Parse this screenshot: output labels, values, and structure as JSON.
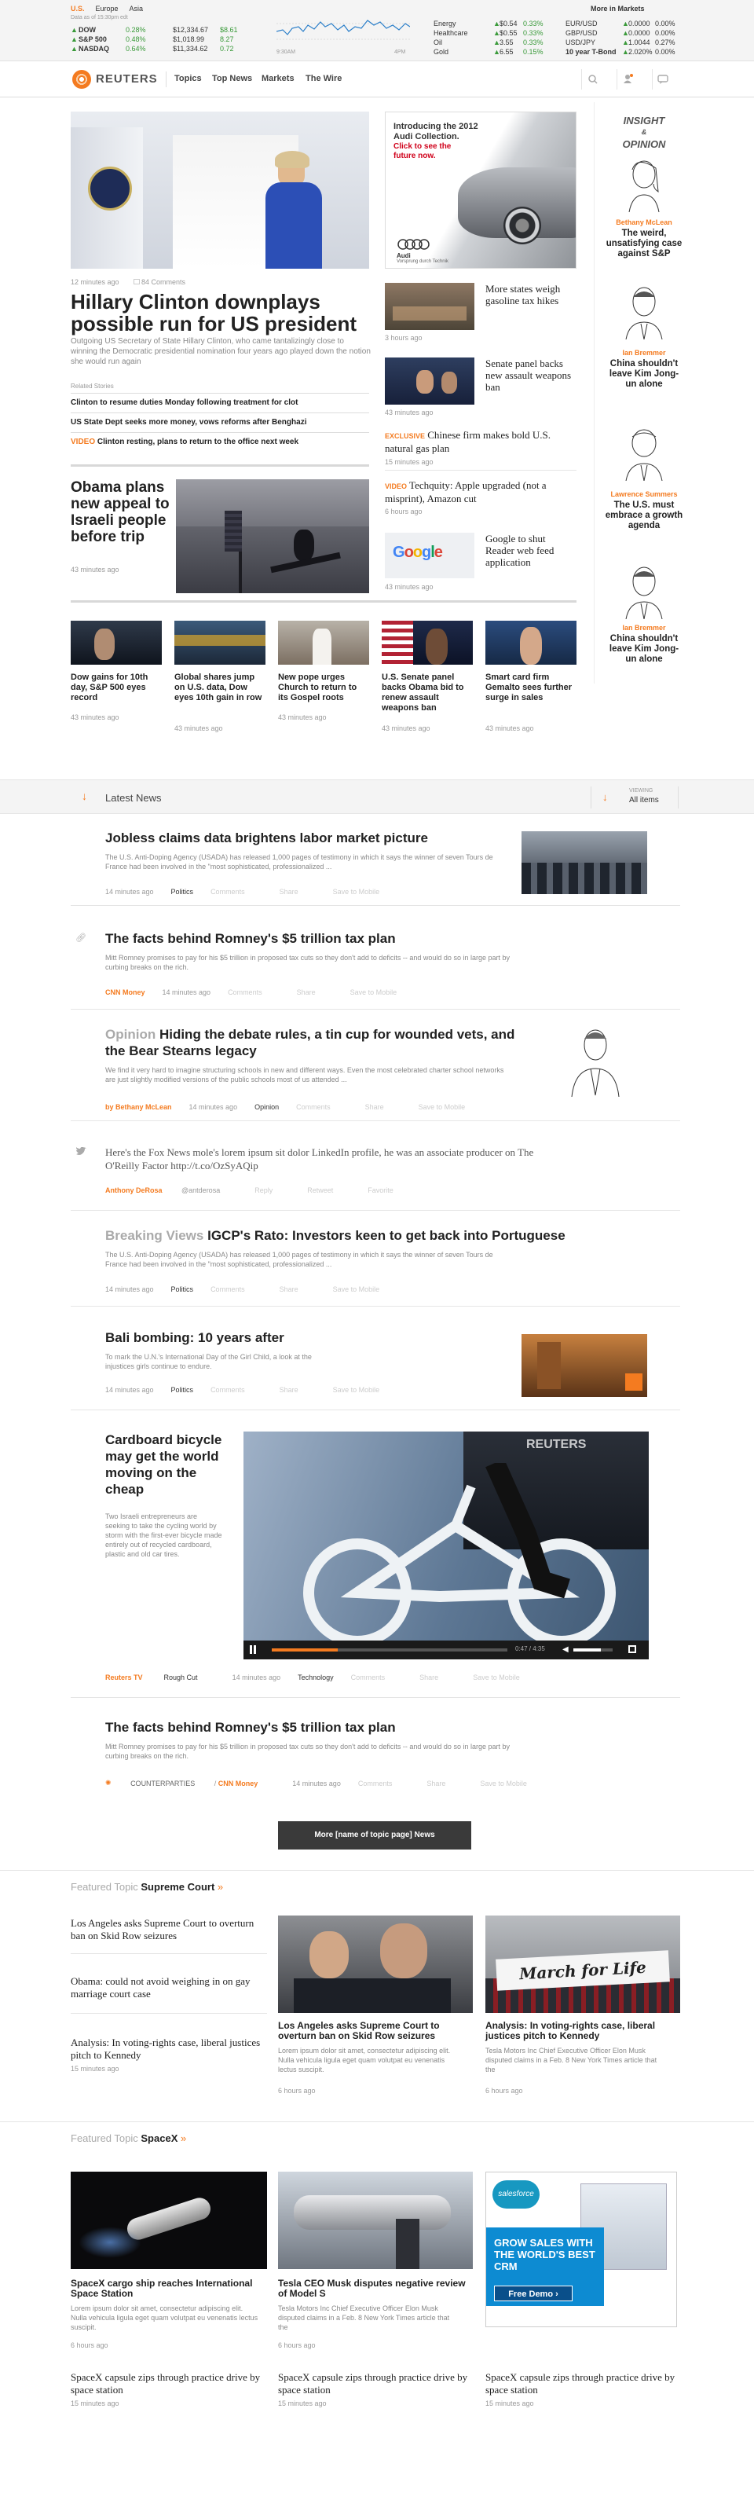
{
  "ticker": {
    "tabs": [
      "U.S.",
      "Europe",
      "Asia"
    ],
    "delay": "Data as of 15:30pm edt",
    "indices": [
      {
        "name": "DOW",
        "val": "$12,334.67",
        "chg": "0.28%",
        "pts": "$8.61"
      },
      {
        "name": "S&P 500",
        "val": "$1,018.99",
        "chg": "0.48%",
        "pts": "8.27"
      },
      {
        "name": "NASDAQ",
        "val": "$11,334.62",
        "chg": "0.64%",
        "pts": "0.72"
      }
    ],
    "chart_axis": "9:30AM",
    "chart_axis_end": "4PM",
    "sectors": [
      {
        "name": "Energy",
        "a": "$0.54",
        "b": "0.33%"
      },
      {
        "name": "Healthcare",
        "a": "$0.55",
        "b": "0.33%"
      },
      {
        "name": "Oil",
        "a": "3.55",
        "b": "0.33%"
      },
      {
        "name": "Gold",
        "a": "6.55",
        "b": "0.15%"
      }
    ],
    "currencies": [
      {
        "name": "EUR/USD",
        "a": "0.0000",
        "b": "0.00%"
      },
      {
        "name": "GBP/USD",
        "a": "0.0000",
        "b": "0.00%"
      },
      {
        "name": "USD/JPY",
        "a": "1.0044",
        "b": "0.27%"
      },
      {
        "name": "10 year T-Bond",
        "a": "2.020%",
        "b": "0.00%"
      }
    ],
    "more": "More in Markets"
  },
  "nav": {
    "brand": "REUTERS",
    "links": [
      "Topics",
      "Top News",
      "Markets",
      "The Wire"
    ]
  },
  "lead": {
    "time": "12 minutes ago",
    "comments": "84 Comments",
    "headline": "Hillary Clinton downplays possible run for US president",
    "summary": "Outgoing US Secretary of State Hillary Clinton, who came tantalizingly close to winning the Democratic presidential nomination four years ago played down the notion she would run again",
    "related_label": "Related Stories",
    "related": [
      {
        "tag": "",
        "text": "Clinton to resume duties Monday following treatment for clot"
      },
      {
        "tag": "",
        "text": "US State Dept seeks more money, vows reforms after Benghazi"
      },
      {
        "tag": "VIDEO",
        "text": "Clinton resting, plans to return to the office next week"
      }
    ]
  },
  "ad": {
    "line1": "Introducing the 2012",
    "line2": "Audi Collection.",
    "cta": "Click to see the future now.",
    "brand": "Audi",
    "tag": "Vorsprung durch Technik"
  },
  "side_stories": [
    {
      "tag": "",
      "title": "More states weigh gasoline tax hikes",
      "time": "3 hours ago"
    },
    {
      "tag": "",
      "title": "Senate panel backs new assault weapons ban",
      "time": "43 minutes ago"
    },
    {
      "tag": "EXCLUSIVE",
      "title": "Chinese firm makes bold U.S. natural gas plan",
      "time": "15 minutes ago"
    },
    {
      "tag": "VIDEO",
      "title": "Techquity: Apple upgraded (not a misprint), Amazon cut",
      "time": "6 hours ago"
    },
    {
      "tag": "",
      "title": "Google to shut Reader web feed application",
      "time": "43 minutes ago"
    }
  ],
  "second": {
    "headline": "Obama plans new appeal to Israeli people before trip",
    "time": "43 minutes ago"
  },
  "opinion": {
    "title1": "INSIGHT",
    "title2": "OPINION",
    "items": [
      {
        "author": "Bethany McLean",
        "title": "The weird, unsatisfying case against S&P"
      },
      {
        "author": "Ian Bremmer",
        "title": "China shouldn't leave Kim Jong-un alone"
      },
      {
        "author": "Lawrence Summers",
        "title": "The U.S. must embrace a growth agenda"
      },
      {
        "author": "Ian Bremmer",
        "title": "China shouldn't leave Kim Jong-un alone"
      }
    ]
  },
  "strip": [
    {
      "title": "Dow gains for 10th day, S&P 500 eyes record",
      "time": "43 minutes ago"
    },
    {
      "title": "Global shares jump on U.S. data, Dow eyes 10th gain in row",
      "time": "43 minutes ago"
    },
    {
      "title": "New pope urges Church to return to its Gospel roots",
      "time": "43 minutes ago"
    },
    {
      "title": "U.S. Senate panel backs Obama bid to renew assault weapons ban",
      "time": "43 minutes ago"
    },
    {
      "title": "Smart card firm Gemalto sees further surge in sales",
      "time": "43 minutes ago"
    }
  ],
  "latest": {
    "label": "Latest News",
    "view_label": "VIEWING",
    "view_value": "All items",
    "actions": {
      "comments": "Comments",
      "share": "Share",
      "save": "Save to Mobile",
      "reply": "Reply",
      "retweet": "Retweet",
      "favorite": "Favorite"
    },
    "items": [
      {
        "kicker": "",
        "title": "Jobless claims data brightens labor market picture",
        "desc": "The U.S. Anti-Doping Agency (USADA) has released 1,000 pages of testimony in which it says the winner of seven Tours de France had been involved in the \"most sophisticated, professionalized ...",
        "time": "14 minutes ago",
        "topic": "Politics"
      },
      {
        "kicker": "",
        "title": "The facts behind Romney's $5 trillion tax plan",
        "desc": "Mitt Romney promises to pay for his $5 trillion in proposed tax cuts so they don't add to deficits -- and would do so in large part by curbing breaks on the rich.",
        "source": "CNN Money",
        "time": "14 minutes ago"
      },
      {
        "kicker": "Opinion",
        "title": "Hiding the debate rules, a tin cup for wounded vets, and the Bear Stearns legacy",
        "desc": "We find it very hard to imagine structuring schools in new and different ways. Even the most celebrated charter school networks are just slightly modified versions of the public schools most of us attended ...",
        "by": "by Bethany McLean",
        "time": "14 minutes ago",
        "topic": "Opinion"
      },
      {
        "tweet": "Here's the Fox News mole's lorem ipsum sit dolor LinkedIn profile, he was an associate producer on The O'Reilly Factor http://t.co/OzSyAQip",
        "handle": "Anthony DeRosa",
        "at": "@antderosa"
      },
      {
        "kicker": "Breaking Views",
        "title": "IGCP's Rato: Investors keen to get back into Portuguese",
        "desc": "The U.S. Anti-Doping Agency (USADA) has released 1,000 pages of testimony in which it says the winner of seven Tours de France had been involved in the \"most sophisticated, professionalized ...",
        "time": "14 minutes ago",
        "topic": "Politics"
      },
      {
        "kicker": "",
        "title": "Bali bombing: 10 years after",
        "desc": "To mark the U.N.'s International Day of the Girl Child, a look at the injustices girls continue to endure.",
        "time": "14 minutes ago",
        "topic": "Politics"
      },
      {
        "title": "Cardboard bicycle may get the world moving on the cheap",
        "desc": "Two Israeli entrepreneurs are seeking to take the cycling world by storm with the first-ever bicycle made entirely out of recycled cardboard, plastic and old car tires.",
        "source": "Reuters TV",
        "source2": "Rough Cut",
        "time": "14 minutes ago",
        "topic": "Technology",
        "video_time": "0:47 / 4:35",
        "watermark": "REUTERS",
        "progress": 0.28,
        "volume": 0.7
      },
      {
        "kicker": "",
        "title": "The facts behind Romney's $5 trillion tax plan",
        "desc": "Mitt Romney promises to pay for his $5 trillion in proposed tax cuts so they don't add to deficits -- and would do so in large part by curbing breaks on the rich.",
        "cp": "COUNTERPARTIES",
        "source": "CNN Money",
        "time": "14 minutes ago"
      }
    ],
    "more": "More [name of topic page] News"
  },
  "topic1": {
    "label": "Featured Topic",
    "name": "Supreme Court",
    "list": [
      {
        "title": "Los Angeles asks Supreme Court to overturn ban on Skid Row seizures",
        "time": ""
      },
      {
        "title": "Obama: could not avoid weighing in on gay marriage court case",
        "time": ""
      },
      {
        "title": "Analysis: In voting-rights case, liberal justices pitch to Kennedy",
        "time": "15 minutes ago"
      }
    ],
    "cards": [
      {
        "title": "Los Angeles asks Supreme Court to overturn ban on Skid Row seizures",
        "desc": "Lorem ipsum dolor sit amet, consectetur adipiscing elit. Nulla vehicula ligula eget quam volutpat eu venenatis lectus suscipit.",
        "time": "6 hours ago"
      },
      {
        "title": "Analysis: In voting-rights case, liberal justices pitch to Kennedy",
        "desc": "Tesla Motors Inc Chief Executive Officer Elon Musk disputed claims in a Feb. 8 New York Times article that the",
        "time": "6 hours ago",
        "banner": "March for Life"
      }
    ]
  },
  "topic2": {
    "label": "Featured Topic",
    "name": "SpaceX",
    "cards": [
      {
        "title": "SpaceX cargo ship reaches International Space Station",
        "desc": "Lorem ipsum dolor sit amet, consectetur adipiscing elit. Nulla vehicula ligula eget quam volutpat eu venenatis lectus suscipit.",
        "time": "6 hours ago"
      },
      {
        "title": "Tesla CEO Musk disputes negative review of Model S",
        "desc": "Tesla Motors Inc Chief Executive Officer Elon Musk disputed claims in a Feb. 8 New York Times article that the",
        "time": "6 hours ago"
      }
    ],
    "ad": {
      "brand": "salesforce",
      "line": "GROW SALES WITH THE WORLD'S BEST CRM",
      "cta": "Free Demo ›"
    },
    "bottom": [
      {
        "title": "SpaceX capsule zips through practice drive by space station",
        "time": "15 minutes ago"
      },
      {
        "title": "SpaceX capsule zips through practice drive by space station",
        "time": "15 minutes ago"
      },
      {
        "title": "SpaceX capsule zips through practice drive by space station",
        "time": "15 minutes ago"
      }
    ]
  },
  "colors": {
    "accent": "#f47b20",
    "green": "#3a9a3a",
    "blue": "#0d8bd2"
  }
}
